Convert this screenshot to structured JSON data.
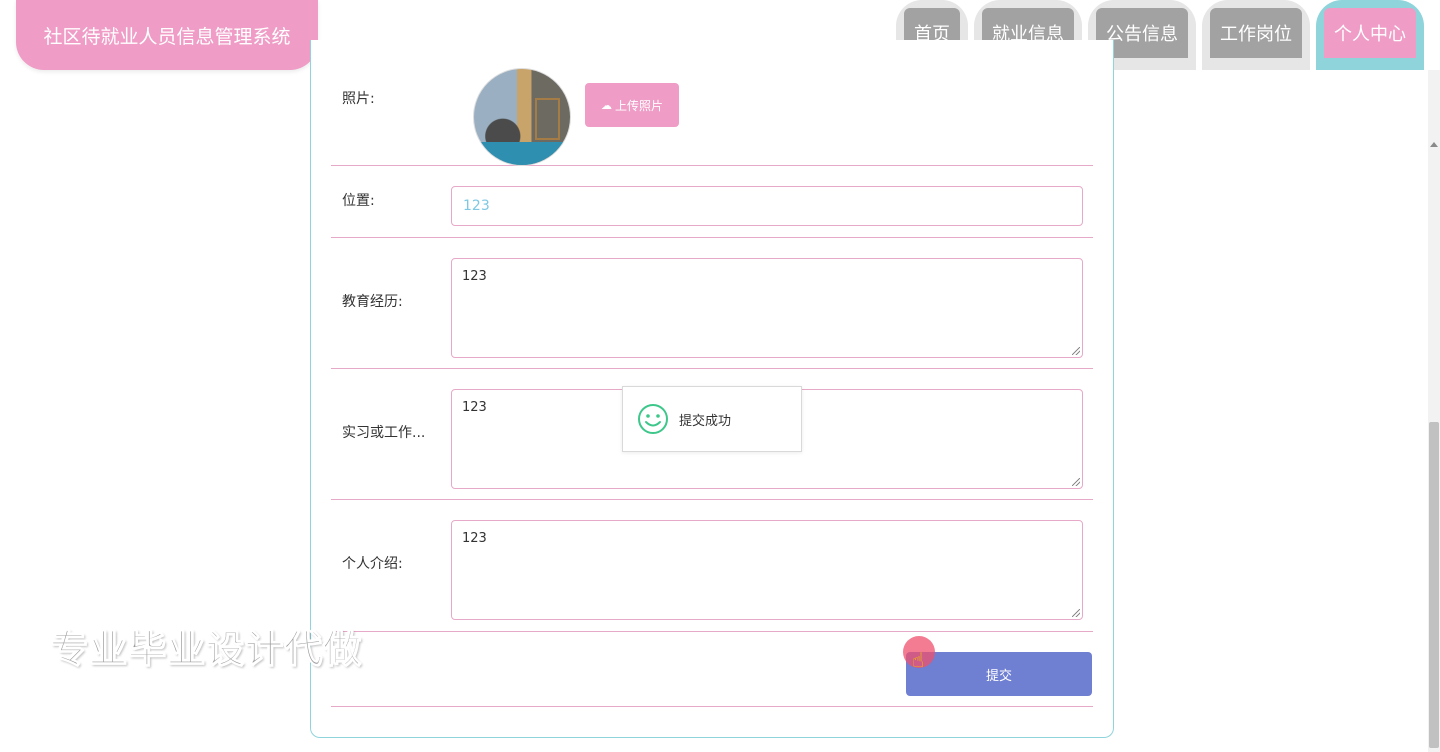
{
  "header": {
    "app_title": "社区待就业人员信息管理系统",
    "nav": [
      {
        "label": "首页",
        "active": false
      },
      {
        "label": "就业信息",
        "active": false
      },
      {
        "label": "公告信息",
        "active": false
      },
      {
        "label": "工作岗位",
        "active": false
      },
      {
        "label": "个人中心",
        "active": true
      }
    ]
  },
  "form": {
    "photo_label": "照片:",
    "upload_button": "上传照片",
    "upload_icon": "cloud-upload-icon",
    "location_label": "位置:",
    "location_value": "123",
    "education_label": "教育经历:",
    "education_value": "123",
    "internship_label": "实习或工作...",
    "internship_value": "123",
    "intro_label": "个人介绍:",
    "intro_value": "123",
    "submit_button": "提交"
  },
  "toast": {
    "message": "提交成功",
    "icon": "smile-icon"
  },
  "watermark": "专业毕业设计代做",
  "colors": {
    "brand_pink": "#ef9cc6",
    "accent_teal": "#8fd4db",
    "submit_blue": "#6f7fd1",
    "nav_gray": "#a2a2a2"
  }
}
